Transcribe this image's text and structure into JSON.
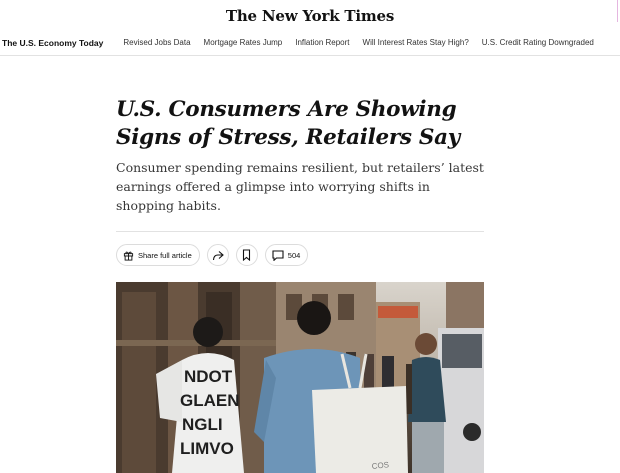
{
  "masthead": {
    "logo": "The New York Times"
  },
  "subnav": {
    "title": "The U.S. Economy Today",
    "links": [
      "Revised Jobs Data",
      "Mortgage Rates Jump",
      "Inflation Report",
      "Will Interest Rates Stay High?",
      "U.S. Credit Rating Downgraded"
    ]
  },
  "article": {
    "headline": "U.S. Consumers Are Showing Signs of Stress, Retailers Say",
    "summary": "Consumer spending remains resilient, but retailers’ latest earnings offered a glimpse into worrying shifts in shopping habits."
  },
  "actions": {
    "share_label": "Share full article",
    "comments_count": "504",
    "icons": [
      "gift-icon",
      "share-arrow-icon",
      "bookmark-icon",
      "comment-icon"
    ]
  },
  "photo": {
    "bag_text": "COS",
    "sweater_text": [
      "NDOT",
      "GLAEN",
      "NGLI",
      "LIMVO"
    ]
  }
}
